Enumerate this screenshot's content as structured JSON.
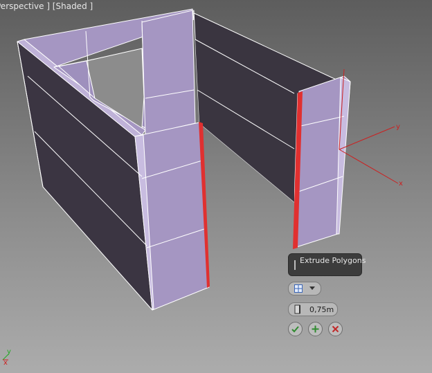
{
  "viewport": {
    "label": "Perspective ] [Shaded ]"
  },
  "gizmo": {
    "x_label": "x",
    "y_label": "y"
  },
  "world_axis": {
    "x_label": "x",
    "y_label": "y"
  },
  "caddy": {
    "title": "Extrude Polygons",
    "height_value": "0,75m",
    "type_icon": "grid-extrusion-icon",
    "buttons": {
      "ok": "checkmark-icon",
      "apply": "plus-icon",
      "cancel": "close-icon"
    }
  },
  "colors": {
    "background_top": "#5f5f5f",
    "background_bottom": "#a8a8a8",
    "wall_face": "#a596c2",
    "wall_dark": "#3a3540",
    "selection": "#e03030",
    "axis_red": "#cc2020",
    "axis_green": "#22aa22"
  }
}
